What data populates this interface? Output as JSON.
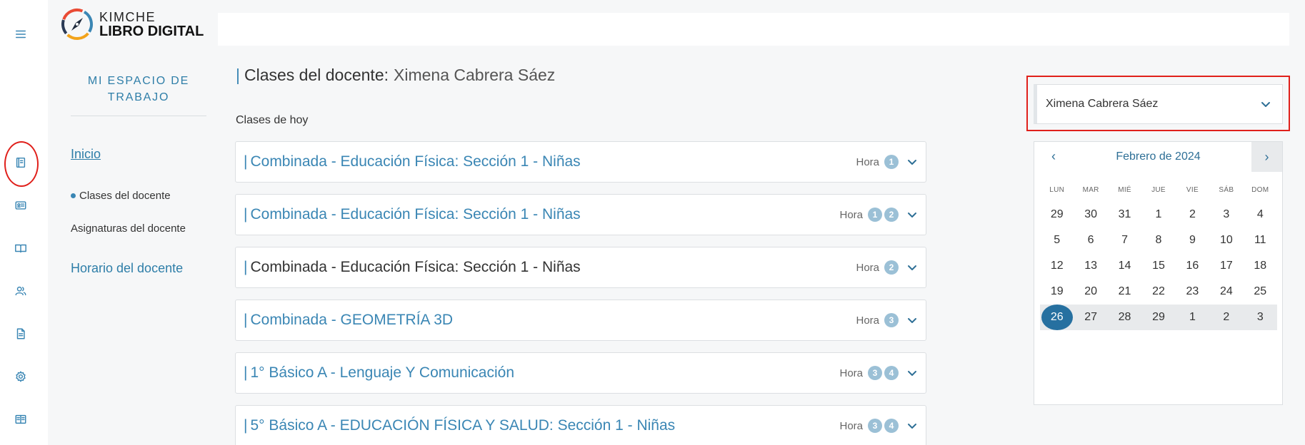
{
  "logo": {
    "line1": "KIMCHE",
    "line2": "LIBRO DIGITAL"
  },
  "rail": {
    "icons": [
      "menu-icon",
      "book-icon",
      "id-card-icon",
      "open-book-icon",
      "users-icon",
      "document-icon",
      "gear-icon",
      "reading-book-icon"
    ]
  },
  "leftnav": {
    "title": "MI ESPACIO DE TRABAJO",
    "inicio": "Inicio",
    "clases": "Clases del docente",
    "asignaturas": "Asignaturas del docente",
    "horario": "Horario del docente"
  },
  "main": {
    "heading_prefix": "Clases del docente:",
    "heading_name": "Ximena Cabrera Sáez",
    "section": "Clases de hoy",
    "hora_label": "Hora",
    "cards": [
      {
        "title": "Combinada - Educación Física: Sección 1 - Niñas",
        "horas": [
          "1"
        ],
        "color": "blue"
      },
      {
        "title": "Combinada - Educación Física: Sección 1 - Niñas",
        "horas": [
          "1",
          "2"
        ],
        "color": "blue"
      },
      {
        "title": "Combinada - Educación Física: Sección 1 - Niñas",
        "horas": [
          "2"
        ],
        "color": "dark"
      },
      {
        "title": "Combinada - GEOMETRÍA 3D",
        "horas": [
          "3"
        ],
        "color": "blue"
      },
      {
        "title": "1° Básico A - Lenguaje Y Comunicación",
        "horas": [
          "3",
          "4"
        ],
        "color": "blue"
      },
      {
        "title": "5° Básico A - EDUCACIÓN FÍSICA Y SALUD: Sección 1 - Niñas",
        "horas": [
          "3",
          "4"
        ],
        "color": "blue"
      }
    ]
  },
  "selector": {
    "value": "Ximena Cabrera Sáez"
  },
  "calendar": {
    "prev": "‹",
    "next": "›",
    "month": "Febrero de 2024",
    "days_of_week": [
      "LUN",
      "MAR",
      "MIÉ",
      "JUE",
      "VIE",
      "SÁB",
      "DOM"
    ],
    "weeks": [
      [
        "29",
        "30",
        "31",
        "1",
        "2",
        "3",
        "4"
      ],
      [
        "5",
        "6",
        "7",
        "8",
        "9",
        "10",
        "11"
      ],
      [
        "12",
        "13",
        "14",
        "15",
        "16",
        "17",
        "18"
      ],
      [
        "19",
        "20",
        "21",
        "22",
        "23",
        "24",
        "25"
      ],
      [
        "26",
        "27",
        "28",
        "29",
        "1",
        "2",
        "3"
      ]
    ],
    "selected_day": "26"
  },
  "colors": {
    "accent": "#3a86b4",
    "selected": "#2670a0",
    "highlight": "#e0201b"
  }
}
